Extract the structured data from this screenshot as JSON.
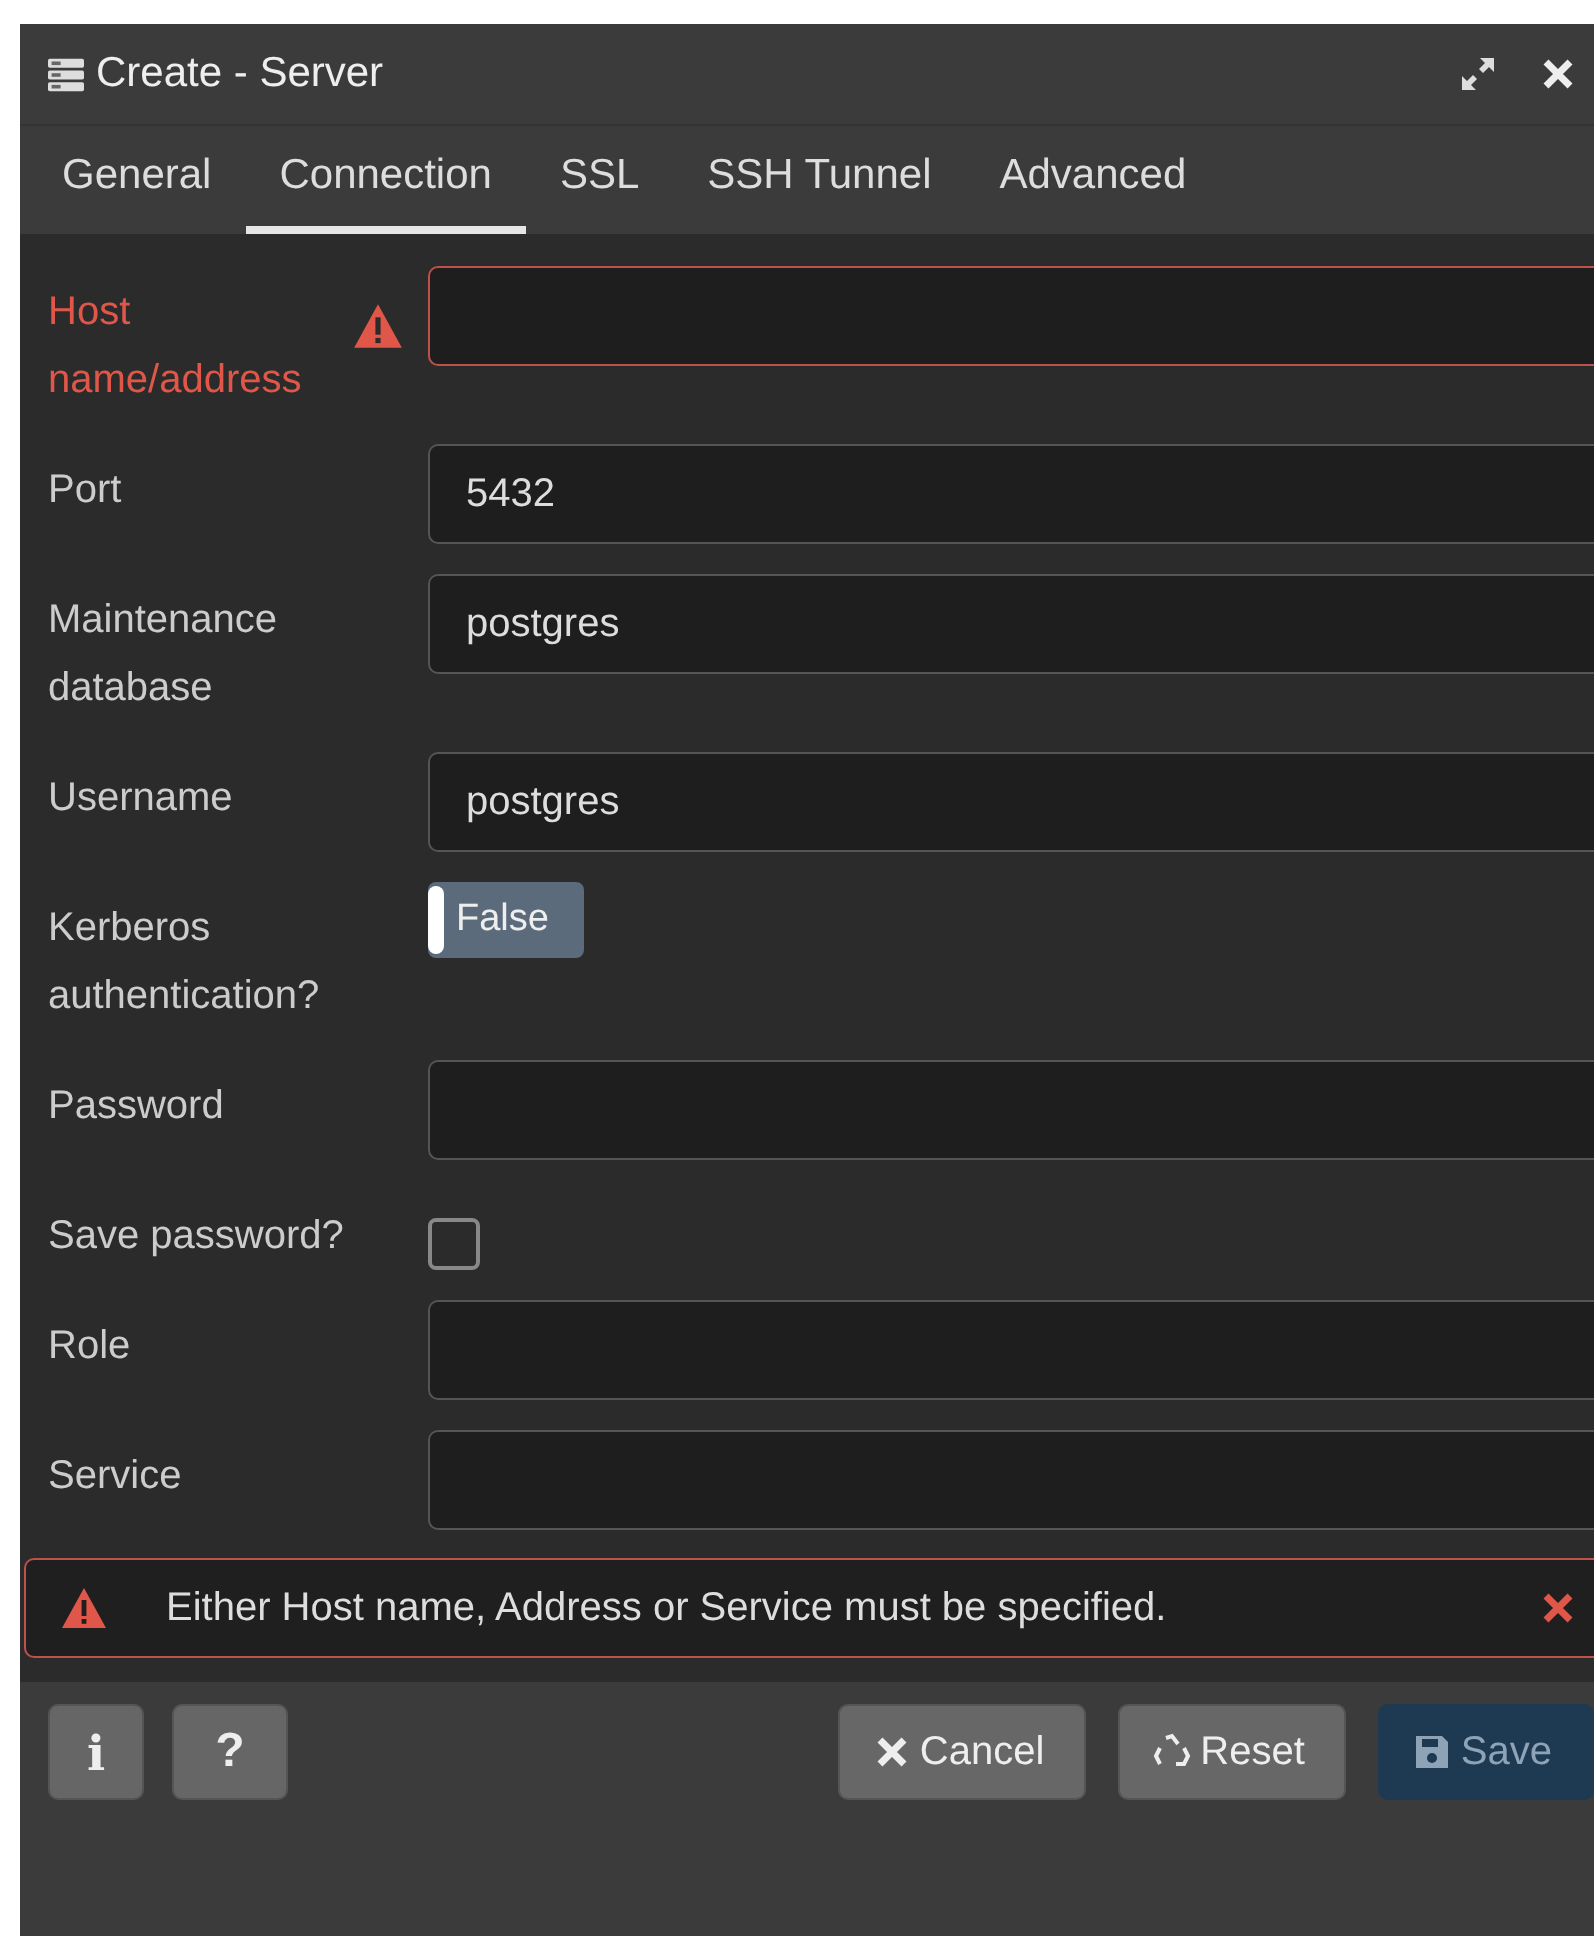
{
  "window": {
    "title": "Create - Server"
  },
  "tabs": [
    {
      "label": "General",
      "selected": false
    },
    {
      "label": "Connection",
      "selected": true
    },
    {
      "label": "SSL",
      "selected": false
    },
    {
      "label": "SSH Tunnel",
      "selected": false
    },
    {
      "label": "Advanced",
      "selected": false
    }
  ],
  "fields": [
    {
      "kind": "text",
      "label": "Host name/address",
      "error": true
    },
    {
      "kind": "text",
      "label": "Port",
      "value": "5432",
      "error": false
    },
    {
      "kind": "text",
      "label": "Maintenance database",
      "value": "postgres",
      "error": false
    },
    {
      "kind": "text",
      "label": "Username",
      "value": "postgres",
      "error": false
    },
    {
      "kind": "switch",
      "label": "Kerberos authentication?",
      "on": false,
      "value": "False"
    },
    {
      "kind": "text",
      "label": "Password",
      "error": false
    },
    {
      "kind": "checkbox",
      "label": "Save password?",
      "checked": false
    },
    {
      "kind": "text",
      "label": "Role",
      "error": false
    },
    {
      "kind": "text",
      "label": "Service",
      "error": false
    }
  ],
  "alert": {
    "message": "Either Host name, Address or Service must be specified."
  },
  "footer": {
    "info_button": "i",
    "help_button": "?",
    "buttons": [
      {
        "kind": "cancel",
        "label": "Cancel",
        "disabled": false
      },
      {
        "kind": "reset",
        "label": "Reset",
        "disabled": false
      },
      {
        "kind": "save",
        "label": "Save",
        "disabled": true
      }
    ]
  }
}
